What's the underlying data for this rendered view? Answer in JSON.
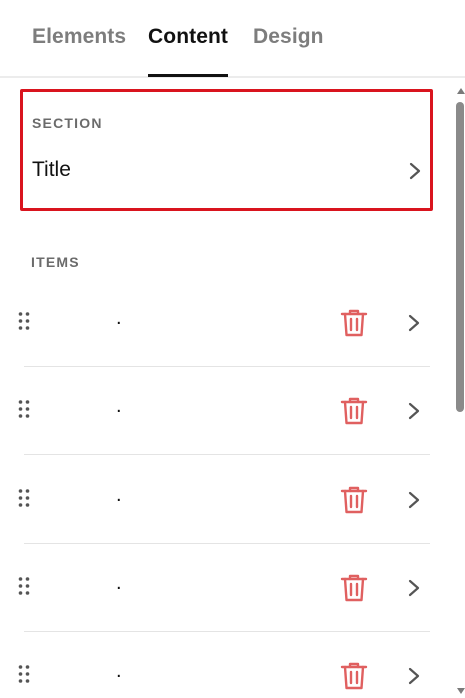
{
  "tabs": [
    {
      "label": "Elements",
      "active": false
    },
    {
      "label": "Content",
      "active": true
    },
    {
      "label": "Design",
      "active": false
    }
  ],
  "section": {
    "heading": "SECTION",
    "title": "Title"
  },
  "items": {
    "heading": "ITEMS",
    "list": [
      {
        "label": "."
      },
      {
        "label": "."
      },
      {
        "label": "."
      },
      {
        "label": "."
      },
      {
        "label": "."
      }
    ]
  },
  "colors": {
    "highlight_border": "#d9141e",
    "delete_icon": "#e06060",
    "active_tab": "#111111",
    "inactive_tab": "#7d7d7d"
  },
  "icons": {
    "drag": "drag-handle-icon",
    "delete": "trash-icon",
    "navigate": "chevron-right-icon"
  }
}
